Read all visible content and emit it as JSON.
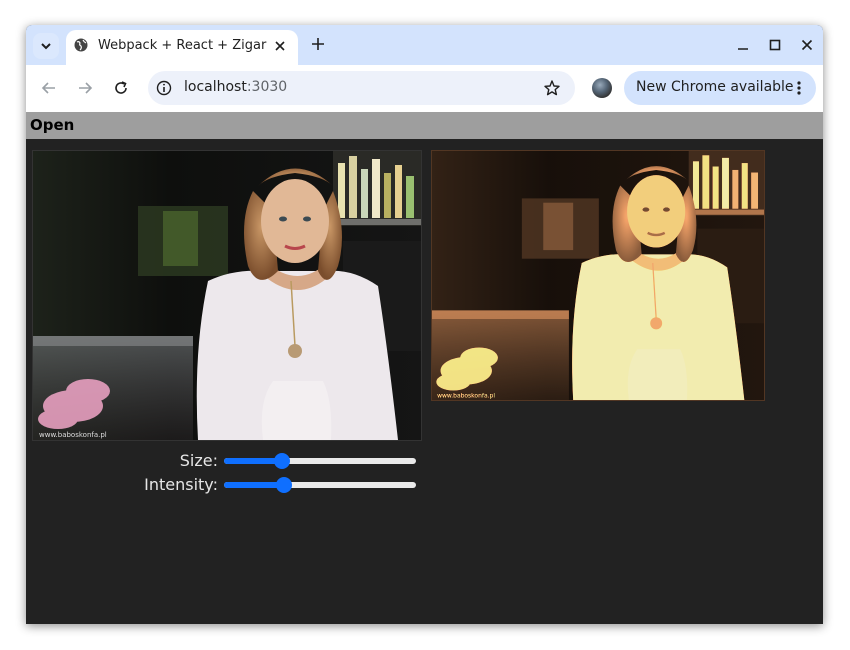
{
  "browser": {
    "tab_title": "Webpack + React + Zigar",
    "url_host": "localhost",
    "url_port": ":3030",
    "update_label": "New Chrome available"
  },
  "menu": {
    "open_label": "Open"
  },
  "controls": {
    "size": {
      "label": "Size:",
      "value": 0.3
    },
    "intensity": {
      "label": "Intensity:",
      "value": 0.31
    }
  },
  "images": {
    "source_caption": "www.baboskonfa.pl",
    "output_caption": "www.baboskonfa.pl"
  },
  "colors": {
    "tabstrip": "#d3e3fd",
    "menubar": "#9e9e9e",
    "content_bg": "#222222",
    "slider_accent": "#0f6fff"
  }
}
